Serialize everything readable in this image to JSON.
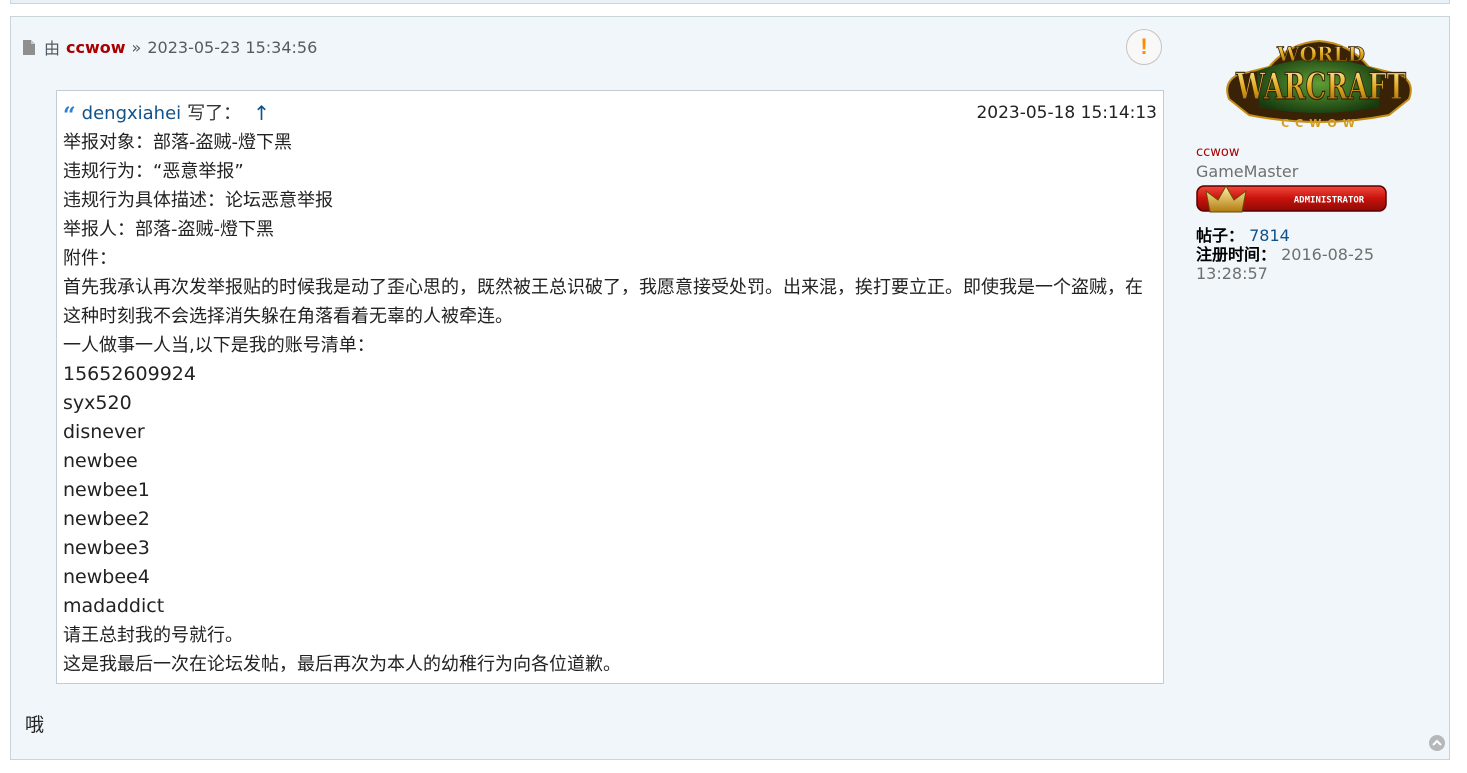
{
  "post": {
    "by_label": "由",
    "author": "ccwow",
    "separator": "»",
    "datetime": "2023-05-23 15:34:56",
    "report_icon": "exclamation-icon",
    "reply_text": "哦"
  },
  "quote": {
    "icon": "quote-icon",
    "user": "dengxiahei",
    "wrote": "写了：",
    "up_arrow": "↑",
    "date": "2023-05-18 15:14:13",
    "lines": [
      "举报对象：部落-盗贼-燈下黑",
      "违规行为：“恶意举报”",
      "违规行为具体描述：论坛恶意举报",
      "举报人：部落-盗贼-燈下黑",
      "附件：",
      "首先我承认再次发举报贴的时候我是动了歪心思的，既然被王总识破了，我愿意接受处罚。出来混，挨打要立正。即使我是一个盗贼，在这种时刻我不会选择消失躲在角落看着无辜的人被牵连。",
      "一人做事一人当,以下是我的账号清单：",
      "15652609924",
      "syx520",
      "disnever",
      "newbee",
      "newbee1",
      "newbee2",
      "newbee3",
      "newbee4",
      "madaddict",
      "请王总封我的号就行。",
      "这是我最后一次在论坛发帖，最后再次为本人的幼稚行为向各位道歉。"
    ]
  },
  "profile": {
    "avatar_text_top": "WORLD",
    "avatar_text_main": "WARCRAFT",
    "avatar_text_sub": "CCWOW",
    "username": "ccwow",
    "rank": "GameMaster",
    "badge_text": "ADMINISTRATOR",
    "posts_label": "帖子：",
    "posts_value": "7814",
    "joined_label": "注册时间：",
    "joined_value": "2016-08-25 13:28:57"
  },
  "colors": {
    "author": "#aa0000",
    "link": "#105289",
    "quote_icon": "#2d80d2",
    "report": "#ff8c00",
    "post_bg": "#f0f6fa"
  }
}
